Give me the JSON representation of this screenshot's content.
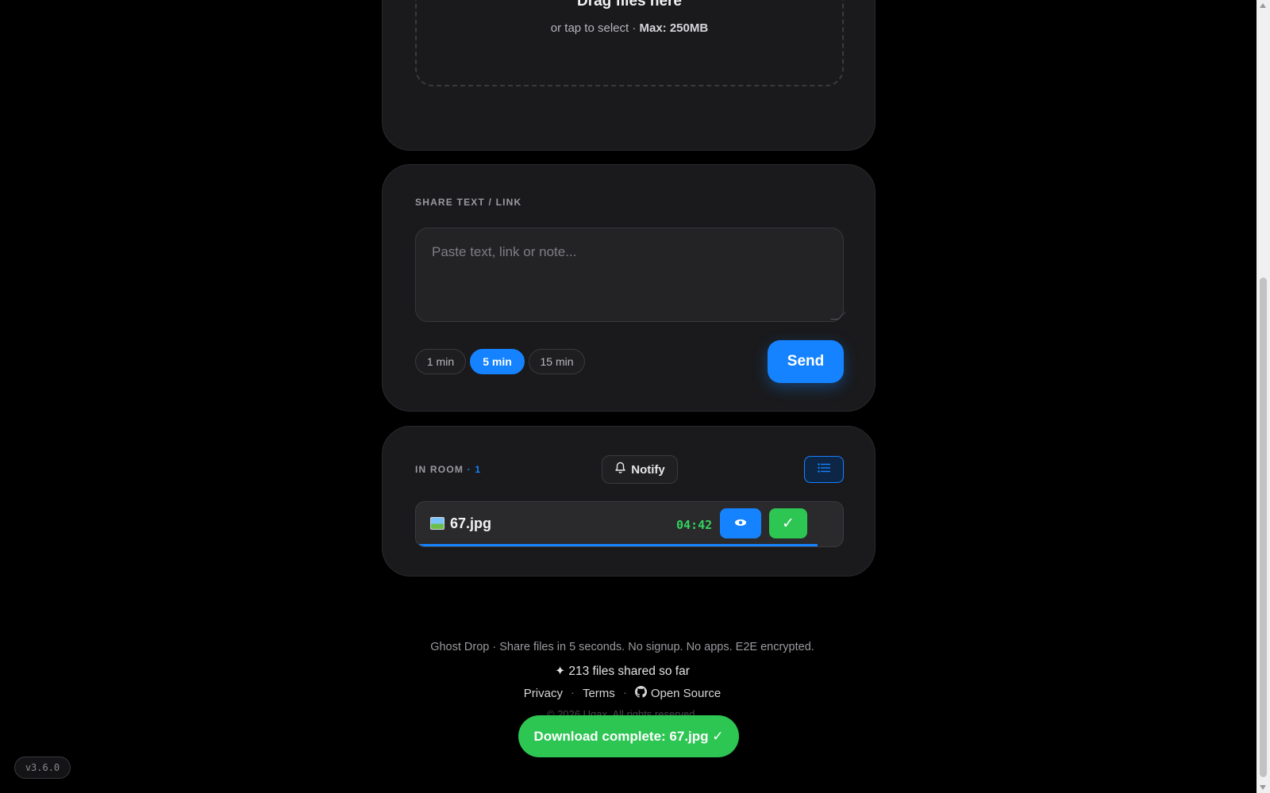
{
  "upload": {
    "title": "Drag files here",
    "subtitle_prefix": "or tap to select · ",
    "max_label": "Max: 250MB"
  },
  "share": {
    "section_label": "SHARE TEXT / LINK",
    "placeholder": "Paste text, link or note...",
    "durations": [
      "1 min",
      "5 min",
      "15 min"
    ],
    "selected_duration": "5 min",
    "send_label": "Send"
  },
  "room": {
    "label": "IN ROOM",
    "count_text": "· 1",
    "notify_label": "Notify",
    "files": [
      {
        "name": "67.jpg",
        "icon": "image-icon",
        "timer": "04:42",
        "progress": 0.94
      }
    ]
  },
  "footer": {
    "tagline": "Ghost Drop · Share files in 5 seconds. No signup. No apps. E2E encrypted.",
    "count": "✦ 213 files shared so far",
    "links": [
      "Privacy",
      "Terms",
      "Open Source"
    ],
    "separator": "·",
    "copyright": "© 2026 Ugax. All rights reserved."
  },
  "toast": {
    "text": "Download complete: 67.jpg ✓"
  },
  "version": "v3.6.0",
  "colors": {
    "accent": "#1583ff",
    "success": "#2dc653",
    "timer": "#33d25d",
    "background": "#000000",
    "card": "#1a1a1c"
  }
}
